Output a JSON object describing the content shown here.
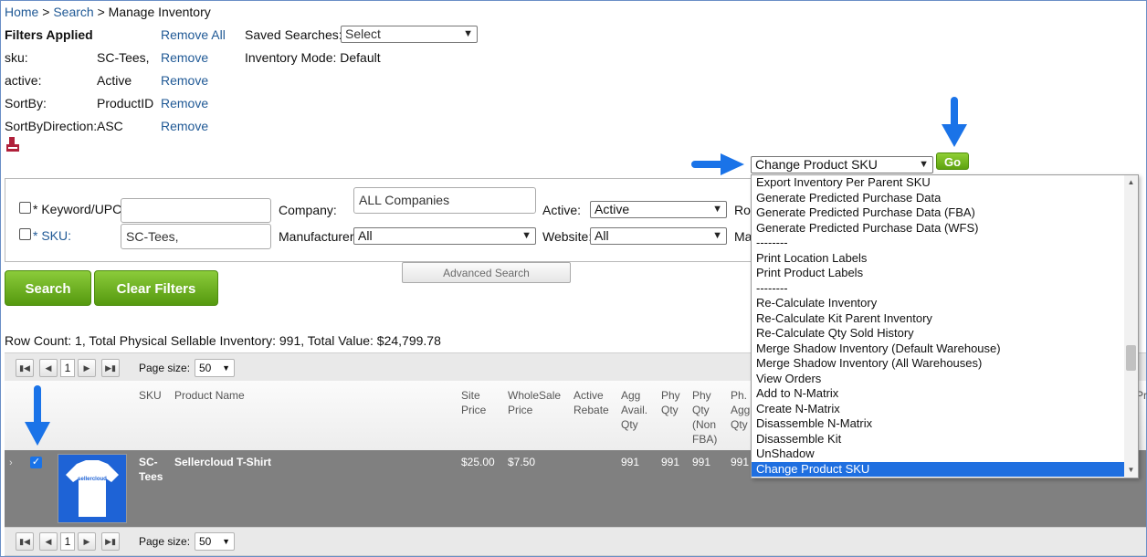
{
  "breadcrumb": {
    "home": "Home",
    "sep1": ">",
    "search": "Search",
    "sep2": ">",
    "current": "Manage Inventory"
  },
  "filters": {
    "title": "Filters Applied",
    "remove_all": "Remove All",
    "rows": [
      {
        "key": "sku:",
        "value": "SC-Tees,",
        "action": "Remove"
      },
      {
        "key": "active:",
        "value": "Active",
        "action": "Remove"
      },
      {
        "key": "SortBy:",
        "value": "ProductID",
        "action": "Remove"
      },
      {
        "key": "SortByDirection:",
        "value": "ASC",
        "action": "Remove"
      }
    ]
  },
  "saved_searches": {
    "label": "Saved Searches:",
    "value": "Select"
  },
  "inventory_mode": "Inventory Mode: Default",
  "action": {
    "selected": "Change Product SKU",
    "go": "Go"
  },
  "search_panel": {
    "keyword_label": "* Keyword/UPC:",
    "keyword_value": "",
    "sku_label": "* SKU:",
    "sku_value": "SC-Tees,",
    "company_label": "Company:",
    "company_value": "ALL Companies",
    "manufacturer_label": "Manufacturer:",
    "manufacturer_value": "All",
    "active_label": "Active:",
    "active_value": "Active",
    "website_label": "Website:",
    "website_value": "All",
    "row_label_cut": "Ro",
    "ma_label_cut": "Ma"
  },
  "buttons": {
    "search": "Search",
    "clear_filters": "Clear Filters",
    "advanced_search": "Advanced Search"
  },
  "summary": "Row Count: 1, Total Physical Sellable Inventory: 991, Total Value: $24,799.78",
  "pager": {
    "page": "1",
    "page_size_label": "Page size:",
    "page_size": "50"
  },
  "grid": {
    "headers": {
      "sku": "SKU",
      "product_name": "Product Name",
      "site_price": [
        "Site",
        "Price"
      ],
      "wholesale_price": [
        "WholeSale",
        "Price"
      ],
      "active_rebate": [
        "Active",
        "Rebate"
      ],
      "agg_avail_qty": [
        "Agg",
        "Avail.",
        "Qty"
      ],
      "phy_qty": [
        "Phy",
        "Qty"
      ],
      "phy_qty_non_fba": [
        "Phy",
        "Qty",
        "(Non",
        "FBA)"
      ],
      "ph_agg": [
        "Ph.",
        "Agg.",
        "Qty"
      ],
      "pr_cut": "Pr"
    },
    "row": {
      "sku": [
        "SC-",
        "Tees"
      ],
      "product_name": "Sellercloud T-Shirt",
      "site_price": "$25.00",
      "wholesale_price": "$7.50",
      "agg_avail_qty": "991",
      "phy_qty": "991",
      "phy_qty_non_fba": "991",
      "ph_agg": "991",
      "shirt_logo": "sellercloud"
    }
  },
  "dropdown_options": [
    "Export Inventory Per Parent SKU",
    "Generate Predicted Purchase Data",
    "Generate Predicted Purchase Data (FBA)",
    "Generate Predicted Purchase Data (WFS)",
    "--------",
    "Print Location Labels",
    "Print Product Labels",
    "--------",
    "Re-Calculate Inventory",
    "Re-Calculate Kit Parent Inventory",
    "Re-Calculate Qty Sold History",
    "Merge Shadow Inventory (Default Warehouse)",
    "Merge Shadow Inventory (All Warehouses)",
    "View Orders",
    "Add to N-Matrix",
    "Create N-Matrix",
    "Disassemble N-Matrix",
    "Disassemble Kit",
    "UnShadow",
    "Change Product SKU"
  ],
  "dropdown_selected_index": 19,
  "colors": {
    "link": "#215a96",
    "green_button": "#6fb322",
    "selected_option": "#1f6fe0",
    "annotation_arrow": "#1a73e8"
  },
  "icons": [
    "pdf-icon",
    "arrow-annotation",
    "pager-first-icon",
    "pager-prev-icon",
    "pager-next-icon",
    "pager-last-icon",
    "expand-row-icon",
    "checkbox-checked-icon",
    "tshirt-image"
  ]
}
